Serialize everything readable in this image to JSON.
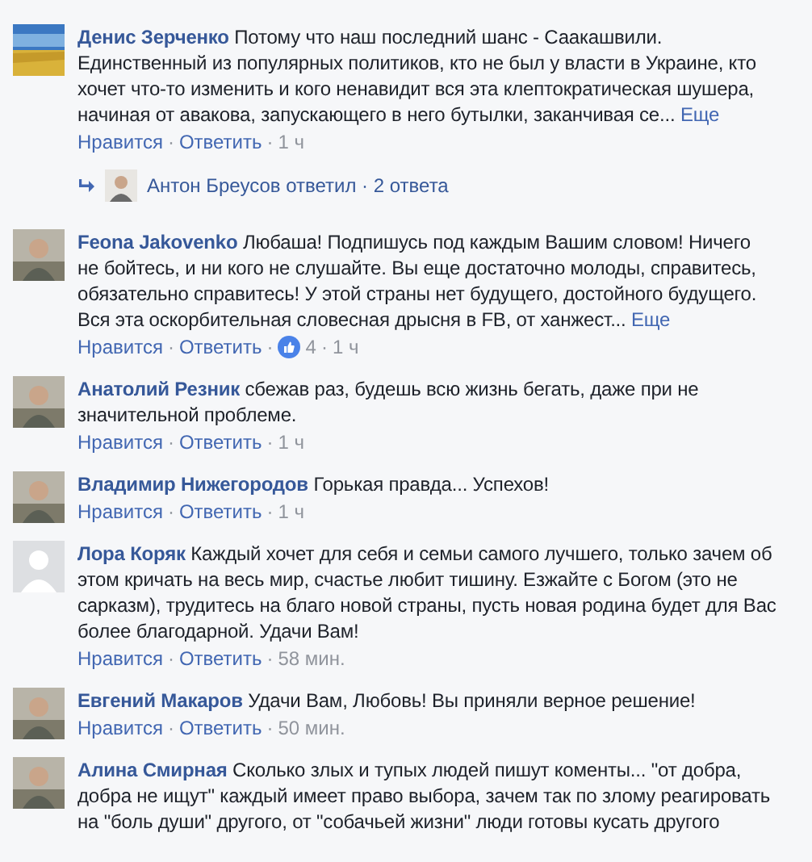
{
  "separator": "·",
  "comments": [
    {
      "author": "Денис Зерченко",
      "kind": "flag",
      "text": "Потому что наш последний шанс - Саакашвили. Единственный из популярных политиков, кто не был у власти в Украине, кто хочет что-то изменить и кого ненавидит вся эта клептократическая шушера, начиная от авакова, запускающего в него бутылки, заканчивая се...",
      "more": "Еще",
      "like": "Нравится",
      "reply": "Ответить",
      "time": "1 ч",
      "replies": {
        "text": "Антон Бреусов ответил · 2 ответа"
      }
    },
    {
      "author": "Feona Jakovenko",
      "text": "Любаша! Подпишусь под каждым Вашим словом! Ничего не бойтесь, и ни кого не слушайте. Вы еще достаточно молоды, справитесь, обязательно справитесь! У этой страны нет будущего, достойного будущего. Вся эта оскорбительная словесная дрысня в FB, от ханжест...",
      "more": "Еще",
      "like": "Нравится",
      "reply": "Ответить",
      "reactions": "4",
      "time": "1 ч"
    },
    {
      "author": "Анатолий Резник",
      "text": "сбежав раз, будешь всю жизнь бегать, даже при не значительной проблеме.",
      "like": "Нравится",
      "reply": "Ответить",
      "time": "1 ч"
    },
    {
      "author": "Владимир Нижегородов",
      "text": "Горькая правда... Успехов!",
      "like": "Нравится",
      "reply": "Ответить",
      "time": "1 ч"
    },
    {
      "author": "Лора Коряк",
      "kind": "default",
      "text": "Каждый хочет для себя и семьи самого лучшего, только зачем об этом кричать на весь мир, счастье любит тишину. Езжайте с Богом (это не сарказм), трудитесь на благо новой страны, пусть новая родина будет для Вас более благодарной. Удачи Вам!",
      "like": "Нравится",
      "reply": "Ответить",
      "time": "58 мин."
    },
    {
      "author": "Евгений Макаров",
      "text": "Удачи Вам, Любовь! Вы приняли верное решение!",
      "like": "Нравится",
      "reply": "Ответить",
      "time": "50 мин."
    },
    {
      "author": "Алина Смирная",
      "text": "Сколько злых и тупых людей пишут коменты... \"от добра, добра не ищут\" каждый имеет право выбора, зачем так по злому реагировать на \"боль души\" другого, от \"собачьей жизни\" люди готовы кусать другого"
    }
  ]
}
